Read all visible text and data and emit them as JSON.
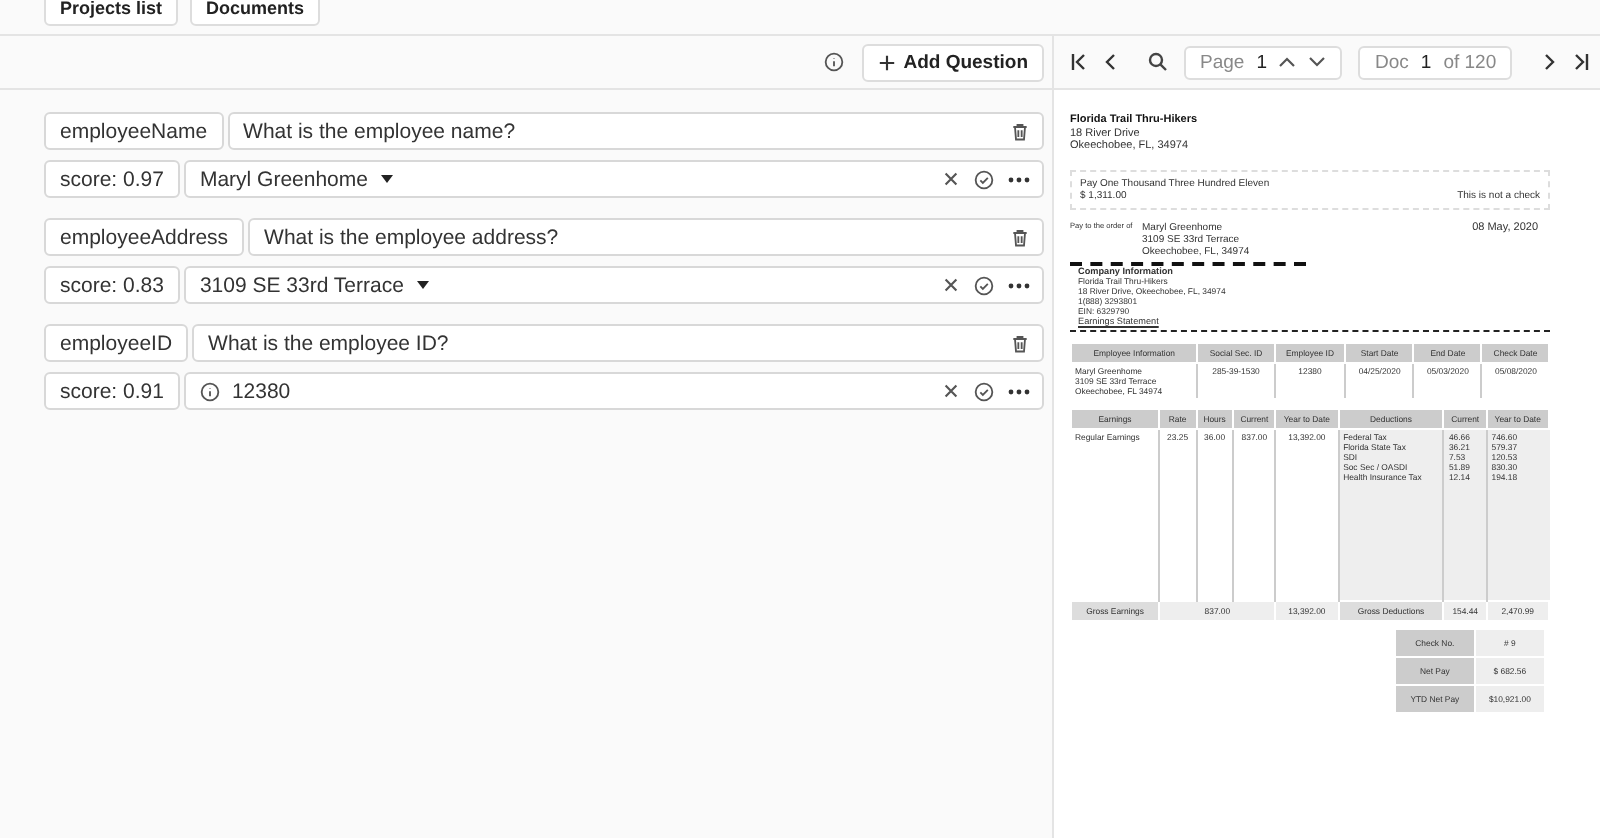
{
  "nav_buttons": [
    "Projects list",
    "Documents"
  ],
  "questions_toolbar": {
    "add_button": "Add Question"
  },
  "questions": [
    {
      "key": "employeeName",
      "question": "What is the employee name?",
      "score": "score: 0.97",
      "answer": "Maryl Greenhome",
      "kind": "dropdown"
    },
    {
      "key": "employeeAddress",
      "question": "What is the employee address?",
      "score": "score: 0.83",
      "answer": "3109 SE 33rd Terrace",
      "kind": "dropdown"
    },
    {
      "key": "employeeID",
      "question": "What is the employee ID?",
      "score": "score: 0.91",
      "answer": "12380",
      "kind": "info"
    }
  ],
  "viewer": {
    "page_label": "Page",
    "page": "1",
    "doc_label": "Doc",
    "doc": "1",
    "doc_total": "of 120"
  },
  "document": {
    "company": [
      "Florida Trail Thru-Hikers",
      "18 River Drive",
      "Okeechobee, FL, 34974"
    ],
    "amount_words": "Pay One Thousand Three Hundred Eleven",
    "amount": "$ 1,311.00",
    "not_check": "This is not a check",
    "pay_to_label": "Pay to the order of",
    "payee": [
      "Maryl Greenhome",
      "3109 SE 33rd Terrace",
      "Okeechobee, FL, 34974"
    ],
    "date": "08 May, 2020",
    "company_info": [
      "Company Information",
      "Florida Trail Thru-Hikers",
      "18 River Drive, Okeechobee, FL, 34974",
      "1(888) 3293801",
      "EIN: 6329790"
    ],
    "statement_title": "Earnings Statement",
    "employee_table": {
      "columns": [
        "Employee Information",
        "Social Sec. ID",
        "Employee ID",
        "Start Date",
        "End Date",
        "Check Date"
      ],
      "row": [
        "Maryl Greenhome\n3109 SE 33rd Terrace\nOkeechobee, FL 34974",
        "285-39-1530",
        "12380",
        "04/25/2020",
        "05/03/2020",
        "05/08/2020"
      ]
    },
    "earnings_table": {
      "columns": [
        "Earnings",
        "Rate",
        "Hours",
        "Current",
        "Year to Date",
        "Deductions",
        "Current",
        "Year to Date"
      ],
      "row": [
        "Regular Earnings",
        "23.25",
        "36.00",
        "837.00",
        "13,392.00",
        "Federal Tax\nFlorida State Tax\nSDI\nSoc Sec / OASDI\nHealth Insurance Tax",
        "46.66\n36.21\n7.53\n51.89\n12.14",
        "746.60\n579.37\n120.53\n830.30\n194.18"
      ],
      "totals": [
        "Gross Earnings",
        "837.00",
        "13,392.00",
        "Gross Deductions",
        "154.44",
        "2,470.99"
      ]
    },
    "summary": [
      [
        "Check No.",
        "# 9"
      ],
      [
        "Net Pay",
        "$ 682.56"
      ],
      [
        "YTD Net Pay",
        "$10,921.00"
      ]
    ]
  }
}
